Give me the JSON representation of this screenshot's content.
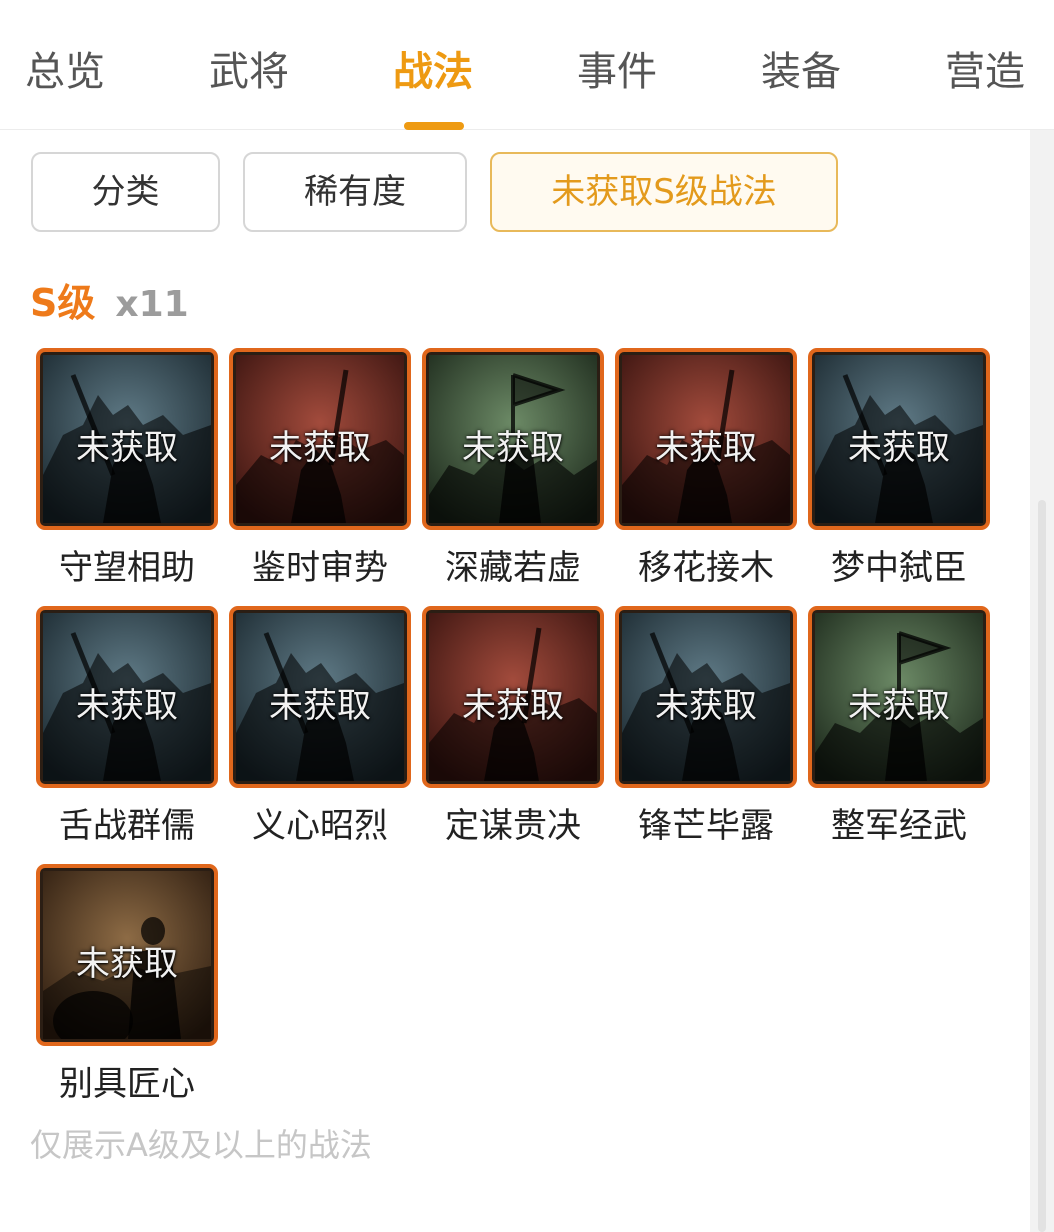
{
  "tabs": [
    {
      "label": "总览",
      "active": false
    },
    {
      "label": "武将",
      "active": false
    },
    {
      "label": "战法",
      "active": true
    },
    {
      "label": "事件",
      "active": false
    },
    {
      "label": "装备",
      "active": false
    },
    {
      "label": "营造",
      "active": false
    }
  ],
  "filters": {
    "category": "分类",
    "rarity": "稀有度",
    "unobtained_s": "未获取S级战法"
  },
  "section": {
    "grade": "S级",
    "count": "x11"
  },
  "card_overlay": "未获取",
  "skills": [
    {
      "name": "守望相助",
      "theme": "blue"
    },
    {
      "name": "鉴时审势",
      "theme": "red"
    },
    {
      "name": "深藏若虚",
      "theme": "green"
    },
    {
      "name": "移花接木",
      "theme": "red"
    },
    {
      "name": "梦中弑臣",
      "theme": "blue"
    },
    {
      "name": "舌战群儒",
      "theme": "blue"
    },
    {
      "name": "义心昭烈",
      "theme": "blue"
    },
    {
      "name": "定谋贵决",
      "theme": "red"
    },
    {
      "name": "锋芒毕露",
      "theme": "blue"
    },
    {
      "name": "整军经武",
      "theme": "green"
    },
    {
      "name": "别具匠心",
      "theme": "brown"
    }
  ],
  "colors": {
    "accent": "#ee9a12",
    "card_border": "#e0671c",
    "grade": "#ee7a1a",
    "blue": [
      "#5f7a86",
      "#1c2a31"
    ],
    "red": [
      "#a24b3c",
      "#3a1410"
    ],
    "green": [
      "#6c8a66",
      "#1d2a1c"
    ],
    "brown": [
      "#8d6b45",
      "#2e1d10"
    ]
  },
  "footer_note": "仅展示A级及以上的战法"
}
